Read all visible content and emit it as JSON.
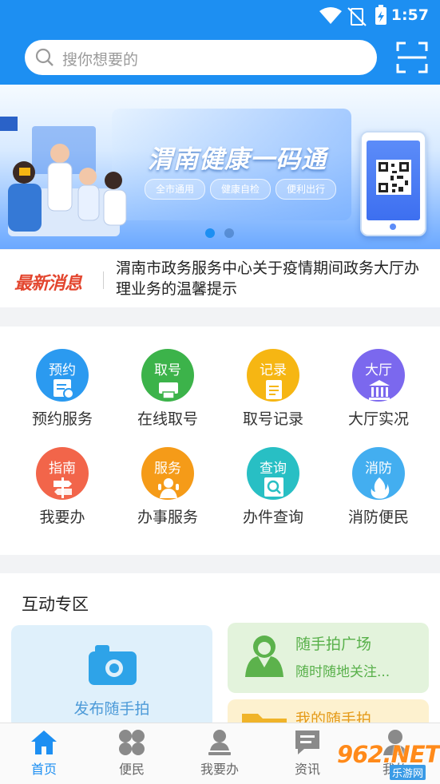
{
  "status": {
    "time": "1:57"
  },
  "search": {
    "placeholder": "搜你想要的"
  },
  "banner": {
    "title": "渭南健康一码通",
    "pills": [
      "全市通用",
      "健康自检",
      "便利出行"
    ]
  },
  "news": {
    "tag": "最新消息",
    "text": "渭南市政务服务中心关于疫情期间政务大厅办理业务的温馨提示"
  },
  "grid": [
    {
      "badge": "预约",
      "label": "预约服务",
      "color": "#2b9af0"
    },
    {
      "badge": "取号",
      "label": "在线取号",
      "color": "#3cb34a"
    },
    {
      "badge": "记录",
      "label": "取号记录",
      "color": "#f6b613"
    },
    {
      "badge": "大厅",
      "label": "大厅实况",
      "color": "#7b68ee"
    },
    {
      "badge": "指南",
      "label": "我要办",
      "color": "#f2654a"
    },
    {
      "badge": "服务",
      "label": "办事服务",
      "color": "#f59b18"
    },
    {
      "badge": "查询",
      "label": "办件查询",
      "color": "#28bfc4"
    },
    {
      "badge": "消防",
      "label": "消防便民",
      "color": "#43aef0"
    }
  ],
  "interact": {
    "title": "互动专区",
    "post_label": "发布随手拍",
    "square_title": "随手拍广场",
    "square_sub": "随时随地关注...",
    "mine_title": "我的随手拍"
  },
  "tabs": [
    {
      "label": "首页",
      "icon": "home-icon",
      "active": true
    },
    {
      "label": "便民",
      "icon": "grid-clover-icon",
      "active": false
    },
    {
      "label": "我要办",
      "icon": "user-stamp-icon",
      "active": false
    },
    {
      "label": "资讯",
      "icon": "message-icon",
      "active": false
    },
    {
      "label": "我的",
      "icon": "person-icon",
      "active": false
    }
  ],
  "watermark": {
    "brand": "962.NET",
    "sub": "乐游网"
  },
  "colors": {
    "primary": "#1d8ff2",
    "accent_red": "#e3452e"
  }
}
